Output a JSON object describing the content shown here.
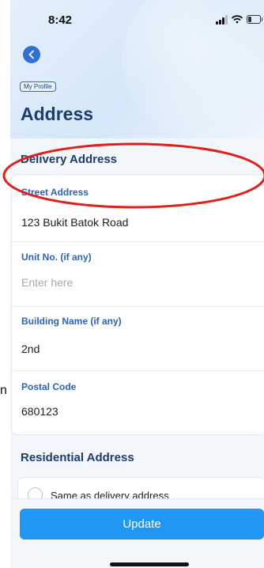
{
  "status_bar": {
    "time": "8:42"
  },
  "header": {
    "breadcrumb": "My Profile",
    "title": "Address"
  },
  "delivery": {
    "section_title": "Delivery Address",
    "fields": [
      {
        "label": "Street Address",
        "value": "123 Bukit Batok Road",
        "placeholder": ""
      },
      {
        "label": "Unit No. (if any)",
        "value": "",
        "placeholder": "Enter here"
      },
      {
        "label": "Building Name (if any)",
        "value": "2nd",
        "placeholder": ""
      },
      {
        "label": "Postal Code",
        "value": "680123",
        "placeholder": ""
      }
    ]
  },
  "residential": {
    "section_title": "Residential Address",
    "same_as_delivery_label": "Same as delivery address",
    "same_as_delivery_checked": false
  },
  "footer": {
    "update_label": "Update"
  },
  "colors": {
    "accent": "#2196f3",
    "title": "#1e3c6e",
    "label": "#2b63b8",
    "annotation": "#e0201b"
  },
  "icons": {
    "back": "chevron-left-icon",
    "signal": "signal-icon",
    "wifi": "wifi-icon",
    "battery": "battery-icon"
  },
  "clipped_left_text": "n"
}
